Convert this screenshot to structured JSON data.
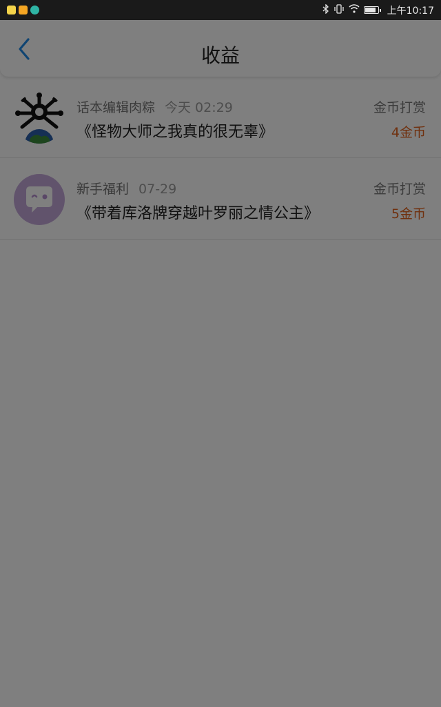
{
  "status_bar": {
    "time": "上午10:17",
    "icons": [
      "bluetooth-icon",
      "vibrate-icon",
      "wifi-icon",
      "battery-icon"
    ],
    "app_icons": [
      "app-icon-yellow",
      "app-icon-gift",
      "app-icon-teal"
    ]
  },
  "header": {
    "title": "收益",
    "back_icon": "chevron-left-icon"
  },
  "records": [
    {
      "source": "话本编辑肉粽",
      "time": "今天 02:29",
      "book": "《怪物大师之我真的很无辜》",
      "type": "金币打赏",
      "amount": "4金币"
    },
    {
      "source": "新手福利",
      "time": "07-29",
      "book": "《带着库洛牌穿越叶罗丽之情公主》",
      "type": "金币打赏",
      "amount": "5金币"
    }
  ],
  "colors": {
    "accent": "#1e88e5",
    "amount": "#e0631e",
    "overlay": "rgba(0,0,0,0.5)",
    "avatar2_bg": "#c3a6d9"
  }
}
